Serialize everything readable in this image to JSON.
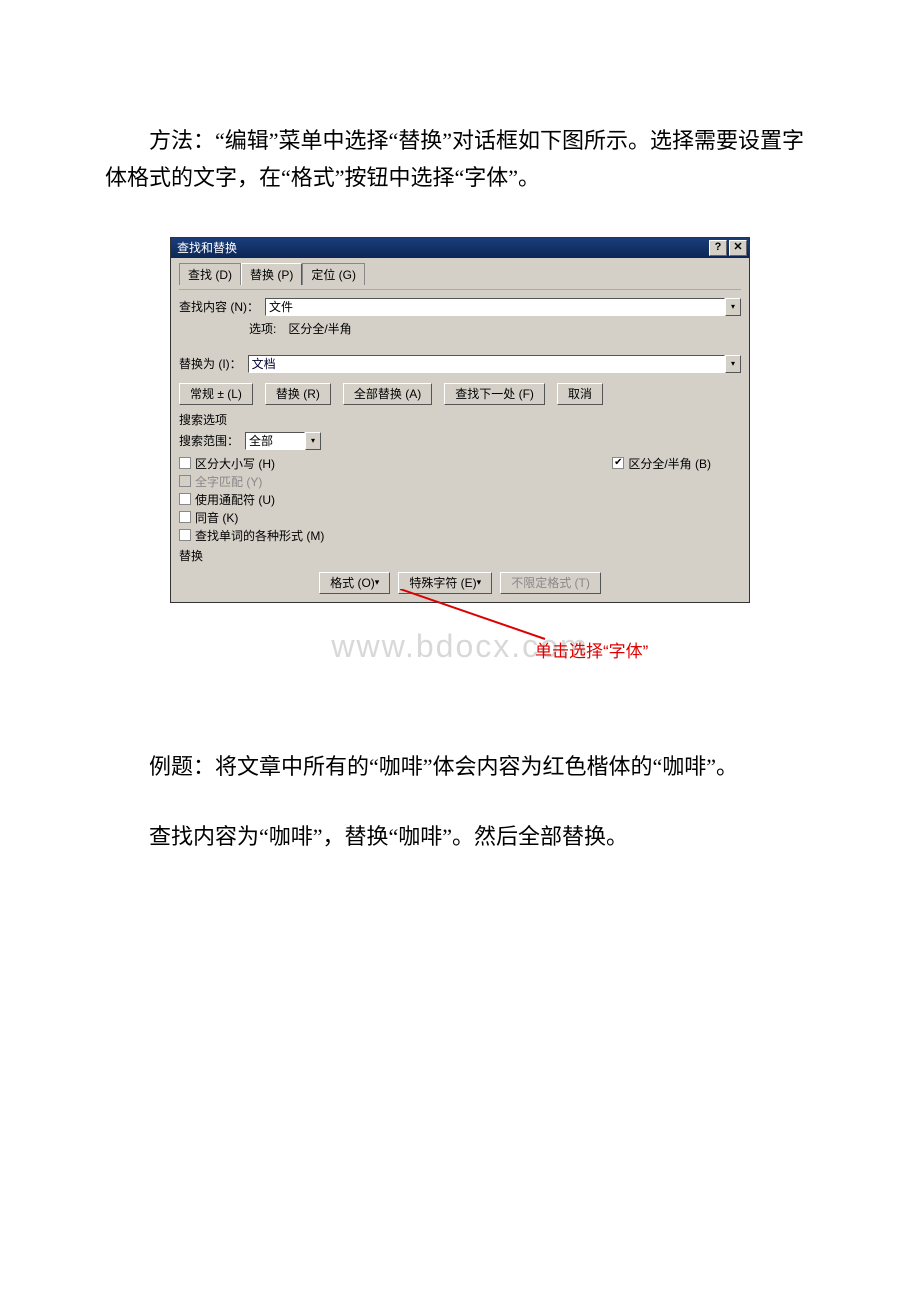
{
  "paragraph1": "方法：“编辑”菜单中选择“替换”对话框如下图所示。选择需要设置字体格式的文字，在“格式”按钮中选择“字体”。",
  "dialog": {
    "title": "查找和替换",
    "help_btn": "?",
    "close_btn": "✕",
    "tabs": {
      "find": "查找 (D)",
      "replace": "替换 (P)",
      "goto": "定位 (G)"
    },
    "find_label": "查找内容 (N)：",
    "find_value": "文件",
    "option_line": "选项:　区分全/半角",
    "replace_label": "替换为 (I)：",
    "replace_value": "文档",
    "buttons": {
      "more": "常规 ± (L)",
      "replace": "替换 (R)",
      "replace_all": "全部替换 (A)",
      "find_next": "查找下一处 (F)",
      "cancel": "取消"
    },
    "search_opts_label": "搜索选项",
    "scope_label": "搜索范围：",
    "scope_value": "全部",
    "checks": {
      "case": "区分大小写 (H)",
      "whole": "全字匹配 (Y)",
      "wildcard": "使用通配符 (U)",
      "sound": "同音 (K)",
      "forms": "查找单词的各种形式 (M)",
      "width": "区分全/半角 (B)"
    },
    "replace_section": "替换",
    "bottom_buttons": {
      "format": "格式 (O)",
      "special": "特殊字符 (E)",
      "noformat": "不限定格式 (T)"
    }
  },
  "annotation": "单击选择“字体”",
  "watermark": "www.bdocx.com",
  "example_line": "例题：将文章中所有的“咖啡”体会内容为红色楷体的“咖啡”。",
  "instruct_line": "查找内容为“咖啡”，替换“咖啡”。然后全部替换。"
}
